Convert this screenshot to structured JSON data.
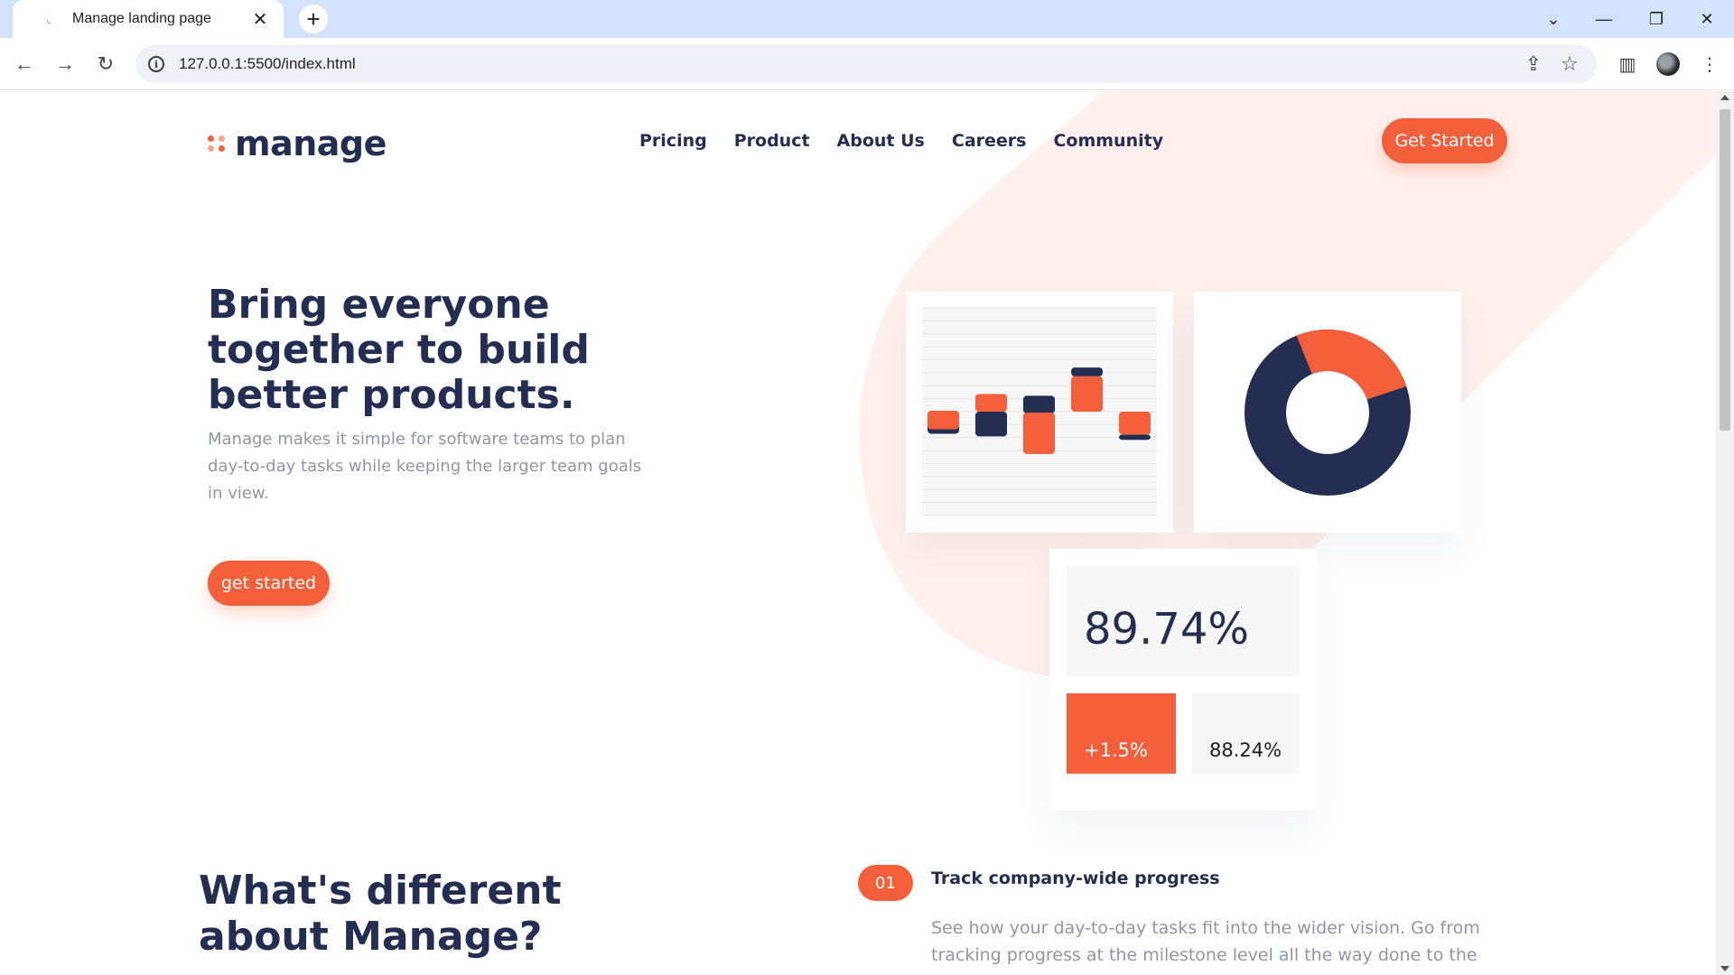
{
  "browser": {
    "tab_title": "Manage landing page",
    "url": "127.0.0.1:5500/index.html",
    "icons": {
      "favicon": "loading-spinner-icon",
      "tab_close": "close-icon",
      "new_tab": "plus-icon",
      "back": "arrow-left-icon",
      "forward": "arrow-right-icon",
      "reload": "reload-icon",
      "site_info": "info-icon",
      "share": "share-icon",
      "bookmark": "star-icon",
      "side_panel": "side-panel-icon",
      "menu": "kebab-menu-icon"
    }
  },
  "page": {
    "logo_text": "manage",
    "nav": [
      "Pricing",
      "Product",
      "About Us",
      "Careers",
      "Community"
    ],
    "nav_cta": "Get Started",
    "hero": {
      "title": "Bring everyone together to build better products.",
      "text": "Manage makes it simple for software teams to plan day-to-day tasks while keeping the larger team goals in view.",
      "cta": "get started"
    },
    "stats": {
      "big": "89.74%",
      "change": "+1.5%",
      "secondary": "88.24%"
    },
    "section": {
      "title": "What's different about Manage?",
      "feature_number": "01",
      "feature_title": "Track company-wide progress",
      "feature_text": "See how your day-to-day tasks fit into the wider vision. Go from tracking progress at the milestone level all the way done to the smallest of details."
    },
    "colors": {
      "accent": "#f25f3a",
      "accent_light": "#fff0ed",
      "navy": "#242d52",
      "muted_text": "#9095a7"
    }
  },
  "illustrations": {
    "bar_chart_segments": [
      {
        "navy": [
          -0.25,
          0
        ],
        "orange": [
          -0.2,
          0.01
        ]
      },
      {
        "navy": [
          -0.28,
          0
        ],
        "orange": [
          0,
          0.2
        ]
      },
      {
        "navy": [
          -0.02,
          0.18
        ],
        "orange": [
          -0.48,
          -0.01
        ]
      },
      {
        "navy": [
          0.4,
          0.5
        ],
        "orange": [
          0,
          0.4
        ]
      },
      {
        "navy": [
          -0.32,
          -0.26
        ],
        "orange": [
          -0.26,
          0
        ]
      }
    ],
    "donut_orange_share": 0.26
  }
}
